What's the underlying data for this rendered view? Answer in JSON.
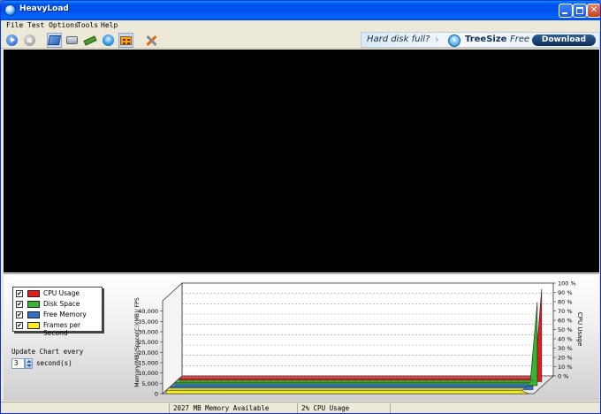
{
  "window": {
    "title": "HeavyLoad"
  },
  "menu": [
    "File",
    "Test Options",
    "Tools",
    "Help"
  ],
  "toolbar": {
    "buttons": [
      {
        "icon": "play-icon",
        "pressed": false
      },
      {
        "icon": "stop-icon",
        "pressed": false
      },
      {
        "icon": "cpu-icon",
        "pressed": true
      },
      {
        "icon": "disk-icon",
        "pressed": false
      },
      {
        "icon": "memory-icon",
        "pressed": false
      },
      {
        "icon": "gpu-icon",
        "pressed": false
      },
      {
        "icon": "grid-icon",
        "pressed": true
      },
      {
        "icon": "tools-icon",
        "pressed": false
      }
    ]
  },
  "ad": {
    "question": "Hard disk full?",
    "product": "TreeSize",
    "edition": "Free",
    "download_label": "Download"
  },
  "legend": {
    "items": [
      {
        "label": "CPU Usage",
        "checked": true,
        "color": "#e31b1b"
      },
      {
        "label": "Disk Space",
        "checked": true,
        "color": "#33b633"
      },
      {
        "label": "Free Memory",
        "checked": true,
        "color": "#2f6fc8"
      },
      {
        "label": "Frames per Second",
        "checked": true,
        "color": "#f7f01c"
      }
    ],
    "check_glyph": "✔"
  },
  "update": {
    "label": "Update Chart every",
    "value": "3",
    "unit": "second(s)"
  },
  "chart_data": {
    "type": "area",
    "left_axis_label": "Memory(MB)/Space(C:)(MB)/ FPS",
    "right_axis_label": "CPU Usage",
    "left_ticks": [
      "0",
      "5,000",
      "10,000",
      "15,000",
      "20,000",
      "25,000",
      "30,000",
      "35,000",
      "40,000"
    ],
    "right_ticks": [
      "0 %",
      "10 %",
      "20 %",
      "30 %",
      "40 %",
      "50 %",
      "60 %",
      "70 %",
      "80 %",
      "90 %",
      "100 %"
    ],
    "series": [
      {
        "name": "CPU Usage",
        "color": "#e31b1b",
        "axis": "right",
        "last_value": 100
      },
      {
        "name": "Disk Space",
        "color": "#33b633",
        "axis": "right",
        "last_value": 90
      },
      {
        "name": "Free Memory",
        "color": "#2f6fc8",
        "axis": "left",
        "last_value": 2027
      },
      {
        "name": "Frames per Second",
        "color": "#f7f01c",
        "axis": "left",
        "last_value": 0
      }
    ]
  },
  "status": {
    "cells": [
      "",
      "2027 MB Memory Available",
      "2% CPU Usage",
      ""
    ]
  },
  "colors": {
    "titlebar": "#0054e3",
    "viewport": "#000000"
  }
}
